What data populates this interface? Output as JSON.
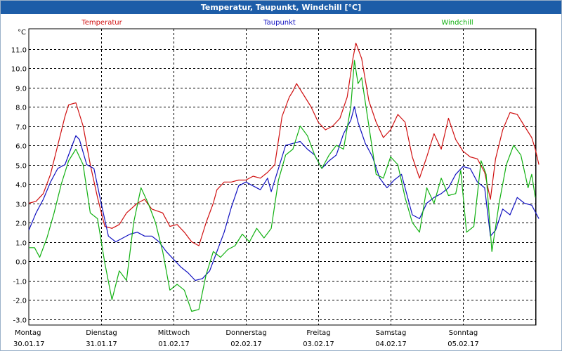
{
  "window": {
    "title": "Temperatur, Taupunkt, Windchill [°C]"
  },
  "chart_data": {
    "type": "line",
    "title": "Temperatur, Taupunkt, Windchill [°C]",
    "ylabel": "°C",
    "ylim": [
      -3.0,
      11.0
    ],
    "xlim": [
      0,
      7
    ],
    "yticks": [
      "11.0",
      "10.0",
      "9.0",
      "8.0",
      "7.0",
      "6.0",
      "5.0",
      "4.0",
      "3.0",
      "2.0",
      "1.0",
      "0.0",
      "-1.0",
      "-2.0",
      "-3.0"
    ],
    "xticks": [
      {
        "day": "Montag",
        "date": "30.01.17"
      },
      {
        "day": "Dienstag",
        "date": "31.01.17"
      },
      {
        "day": "Mittwoch",
        "date": "01.02.17"
      },
      {
        "day": "Donnerstag",
        "date": "02.02.17"
      },
      {
        "day": "Freitag",
        "date": "03.02.17"
      },
      {
        "day": "Samstag",
        "date": "04.02.17"
      },
      {
        "day": "Sonntag",
        "date": "05.02.17"
      }
    ],
    "grid": true,
    "legend": "top",
    "series": [
      {
        "name": "Temperatur",
        "color": "#d01010",
        "points": [
          [
            0,
            3.0
          ],
          [
            0.1,
            3.1
          ],
          [
            0.2,
            3.5
          ],
          [
            0.3,
            4.5
          ],
          [
            0.4,
            6.0
          ],
          [
            0.5,
            7.5
          ],
          [
            0.55,
            8.1
          ],
          [
            0.65,
            8.2
          ],
          [
            0.75,
            7.0
          ],
          [
            0.85,
            5.0
          ],
          [
            0.95,
            3.3
          ],
          [
            1.05,
            1.8
          ],
          [
            1.15,
            1.7
          ],
          [
            1.25,
            1.9
          ],
          [
            1.35,
            2.5
          ],
          [
            1.5,
            3.0
          ],
          [
            1.6,
            3.2
          ],
          [
            1.7,
            2.7
          ],
          [
            1.85,
            2.5
          ],
          [
            1.95,
            1.8
          ],
          [
            2.05,
            1.9
          ],
          [
            2.15,
            1.5
          ],
          [
            2.25,
            1.0
          ],
          [
            2.35,
            0.8
          ],
          [
            2.45,
            2.0
          ],
          [
            2.55,
            3.0
          ],
          [
            2.6,
            3.7
          ],
          [
            2.7,
            4.1
          ],
          [
            2.8,
            4.1
          ],
          [
            2.9,
            4.2
          ],
          [
            3.0,
            4.2
          ],
          [
            3.1,
            4.4
          ],
          [
            3.2,
            4.3
          ],
          [
            3.3,
            4.6
          ],
          [
            3.4,
            5.0
          ],
          [
            3.5,
            7.5
          ],
          [
            3.6,
            8.5
          ],
          [
            3.65,
            8.8
          ],
          [
            3.7,
            9.2
          ],
          [
            3.8,
            8.6
          ],
          [
            3.9,
            8.0
          ],
          [
            4.0,
            7.2
          ],
          [
            4.1,
            6.8
          ],
          [
            4.2,
            7.0
          ],
          [
            4.3,
            7.4
          ],
          [
            4.4,
            8.5
          ],
          [
            4.48,
            10.5
          ],
          [
            4.52,
            11.3
          ],
          [
            4.6,
            10.5
          ],
          [
            4.7,
            8.3
          ],
          [
            4.8,
            7.2
          ],
          [
            4.9,
            6.4
          ],
          [
            5.0,
            6.8
          ],
          [
            5.1,
            7.6
          ],
          [
            5.2,
            7.2
          ],
          [
            5.3,
            5.4
          ],
          [
            5.4,
            4.3
          ],
          [
            5.5,
            5.4
          ],
          [
            5.6,
            6.6
          ],
          [
            5.7,
            5.8
          ],
          [
            5.8,
            7.4
          ],
          [
            5.9,
            6.3
          ],
          [
            6.0,
            5.7
          ],
          [
            6.1,
            5.4
          ],
          [
            6.2,
            5.3
          ],
          [
            6.3,
            4.6
          ],
          [
            6.38,
            3.2
          ],
          [
            6.45,
            5.3
          ],
          [
            6.55,
            6.8
          ],
          [
            6.65,
            7.7
          ],
          [
            6.75,
            7.6
          ],
          [
            6.85,
            7.0
          ],
          [
            6.95,
            6.4
          ],
          [
            7.0,
            5.8
          ],
          [
            7.05,
            5.0
          ]
        ]
      },
      {
        "name": "Taupunkt",
        "color": "#1010c0",
        "points": [
          [
            0,
            1.6
          ],
          [
            0.1,
            2.5
          ],
          [
            0.2,
            3.2
          ],
          [
            0.3,
            4.1
          ],
          [
            0.4,
            4.8
          ],
          [
            0.5,
            5.0
          ],
          [
            0.6,
            6.0
          ],
          [
            0.65,
            6.5
          ],
          [
            0.7,
            6.3
          ],
          [
            0.8,
            5.0
          ],
          [
            0.9,
            4.8
          ],
          [
            1.0,
            3.0
          ],
          [
            1.1,
            1.3
          ],
          [
            1.2,
            1.0
          ],
          [
            1.3,
            1.2
          ],
          [
            1.4,
            1.4
          ],
          [
            1.5,
            1.5
          ],
          [
            1.6,
            1.3
          ],
          [
            1.7,
            1.3
          ],
          [
            1.8,
            1.0
          ],
          [
            1.9,
            0.5
          ],
          [
            2.0,
            0.1
          ],
          [
            2.1,
            -0.3
          ],
          [
            2.2,
            -0.6
          ],
          [
            2.3,
            -1.0
          ],
          [
            2.4,
            -0.9
          ],
          [
            2.5,
            -0.5
          ],
          [
            2.6,
            0.5
          ],
          [
            2.7,
            1.5
          ],
          [
            2.8,
            2.8
          ],
          [
            2.9,
            3.9
          ],
          [
            3.0,
            4.1
          ],
          [
            3.1,
            3.9
          ],
          [
            3.2,
            3.7
          ],
          [
            3.3,
            4.3
          ],
          [
            3.35,
            3.6
          ],
          [
            3.45,
            4.8
          ],
          [
            3.55,
            6.0
          ],
          [
            3.65,
            6.1
          ],
          [
            3.75,
            6.2
          ],
          [
            3.85,
            5.8
          ],
          [
            3.95,
            5.5
          ],
          [
            4.05,
            4.8
          ],
          [
            4.15,
            5.2
          ],
          [
            4.25,
            5.5
          ],
          [
            4.35,
            6.6
          ],
          [
            4.45,
            7.3
          ],
          [
            4.5,
            8.0
          ],
          [
            4.55,
            7.2
          ],
          [
            4.65,
            6.1
          ],
          [
            4.75,
            5.4
          ],
          [
            4.85,
            4.3
          ],
          [
            4.95,
            3.8
          ],
          [
            5.05,
            4.2
          ],
          [
            5.15,
            4.5
          ],
          [
            5.2,
            3.8
          ],
          [
            5.3,
            2.4
          ],
          [
            5.4,
            2.2
          ],
          [
            5.5,
            3.0
          ],
          [
            5.6,
            3.3
          ],
          [
            5.7,
            3.5
          ],
          [
            5.8,
            3.8
          ],
          [
            5.9,
            4.5
          ],
          [
            6.0,
            4.9
          ],
          [
            6.1,
            4.8
          ],
          [
            6.2,
            4.1
          ],
          [
            6.3,
            3.8
          ],
          [
            6.38,
            1.3
          ],
          [
            6.45,
            1.6
          ],
          [
            6.55,
            2.7
          ],
          [
            6.65,
            2.4
          ],
          [
            6.75,
            3.3
          ],
          [
            6.85,
            3.0
          ],
          [
            6.95,
            2.9
          ],
          [
            7.05,
            2.2
          ]
        ]
      },
      {
        "name": "Windchill",
        "color": "#10b010",
        "points": [
          [
            0,
            0.7
          ],
          [
            0.08,
            0.7
          ],
          [
            0.15,
            0.2
          ],
          [
            0.25,
            1.2
          ],
          [
            0.35,
            2.5
          ],
          [
            0.45,
            4.0
          ],
          [
            0.55,
            5.2
          ],
          [
            0.65,
            5.8
          ],
          [
            0.75,
            5.0
          ],
          [
            0.85,
            2.5
          ],
          [
            0.95,
            2.2
          ],
          [
            1.05,
            -0.1
          ],
          [
            1.15,
            -2.0
          ],
          [
            1.25,
            -0.5
          ],
          [
            1.35,
            -1.0
          ],
          [
            1.45,
            2.0
          ],
          [
            1.55,
            3.8
          ],
          [
            1.65,
            3.0
          ],
          [
            1.75,
            2.0
          ],
          [
            1.85,
            0.5
          ],
          [
            1.95,
            -1.5
          ],
          [
            2.05,
            -1.2
          ],
          [
            2.15,
            -1.5
          ],
          [
            2.25,
            -2.6
          ],
          [
            2.35,
            -2.5
          ],
          [
            2.45,
            -0.7
          ],
          [
            2.55,
            0.5
          ],
          [
            2.65,
            0.2
          ],
          [
            2.75,
            0.6
          ],
          [
            2.85,
            0.8
          ],
          [
            2.95,
            1.4
          ],
          [
            3.05,
            1.0
          ],
          [
            3.15,
            1.7
          ],
          [
            3.25,
            1.2
          ],
          [
            3.35,
            1.7
          ],
          [
            3.45,
            4.2
          ],
          [
            3.55,
            5.5
          ],
          [
            3.65,
            5.8
          ],
          [
            3.75,
            7.0
          ],
          [
            3.85,
            6.5
          ],
          [
            3.95,
            5.5
          ],
          [
            4.05,
            4.8
          ],
          [
            4.15,
            5.5
          ],
          [
            4.25,
            6.0
          ],
          [
            4.35,
            5.8
          ],
          [
            4.45,
            8.0
          ],
          [
            4.5,
            10.4
          ],
          [
            4.55,
            9.2
          ],
          [
            4.6,
            9.5
          ],
          [
            4.7,
            7.0
          ],
          [
            4.8,
            4.5
          ],
          [
            4.9,
            4.3
          ],
          [
            5.0,
            5.4
          ],
          [
            5.1,
            5.0
          ],
          [
            5.2,
            3.3
          ],
          [
            5.3,
            2.0
          ],
          [
            5.4,
            1.5
          ],
          [
            5.5,
            3.8
          ],
          [
            5.6,
            3.0
          ],
          [
            5.7,
            4.3
          ],
          [
            5.8,
            3.4
          ],
          [
            5.9,
            3.5
          ],
          [
            5.97,
            4.7
          ],
          [
            6.05,
            1.5
          ],
          [
            6.15,
            1.8
          ],
          [
            6.25,
            5.2
          ],
          [
            6.32,
            4.5
          ],
          [
            6.4,
            0.5
          ],
          [
            6.5,
            3.0
          ],
          [
            6.6,
            5.0
          ],
          [
            6.7,
            6.0
          ],
          [
            6.8,
            5.5
          ],
          [
            6.9,
            3.8
          ],
          [
            6.95,
            4.5
          ],
          [
            7.0,
            3.3
          ]
        ]
      }
    ]
  }
}
